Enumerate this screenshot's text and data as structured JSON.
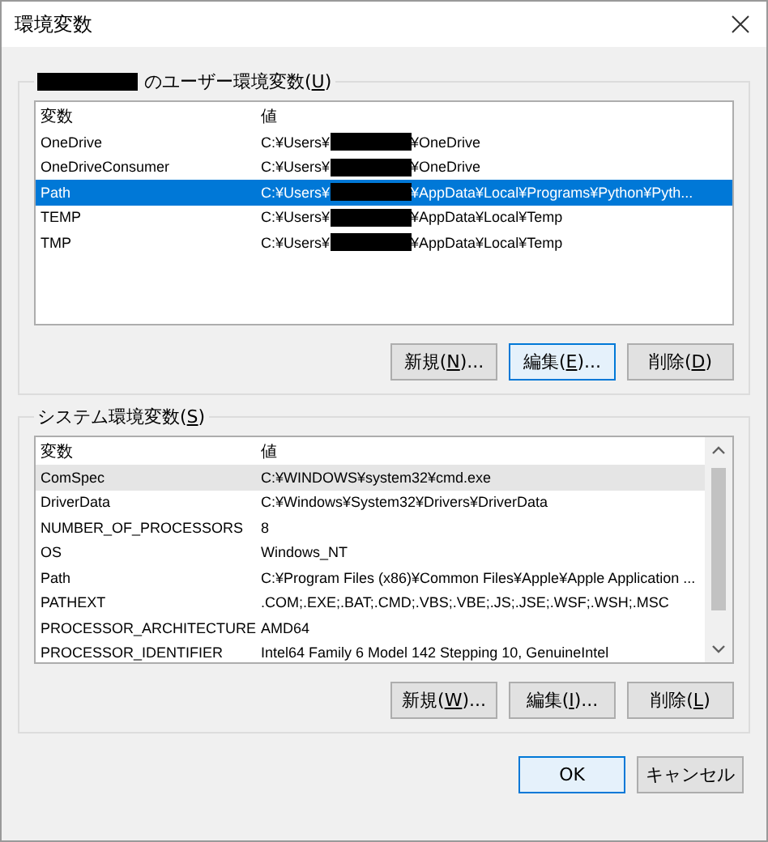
{
  "window": {
    "title": "環境変数"
  },
  "user_group": {
    "label_redacted": true,
    "label_parts": [
      "のユーザー環境変数(",
      "U",
      ")"
    ],
    "list": {
      "focused": true,
      "columns": [
        "変数",
        "値"
      ],
      "rows": [
        {
          "name": "OneDrive",
          "value_prefix": "C:¥Users¥",
          "redacted": true,
          "value_suffix": "¥OneDrive",
          "selected": false
        },
        {
          "name": "OneDriveConsumer",
          "value_prefix": "C:¥Users¥",
          "redacted": true,
          "value_suffix": "¥OneDrive",
          "selected": false
        },
        {
          "name": "Path",
          "value_prefix": "C:¥Users¥",
          "redacted": true,
          "value_suffix": "¥AppData¥Local¥Programs¥Python¥Pyth...",
          "selected": true
        },
        {
          "name": "TEMP",
          "value_prefix": "C:¥Users¥",
          "redacted": true,
          "value_suffix": "¥AppData¥Local¥Temp",
          "selected": false
        },
        {
          "name": "TMP",
          "value_prefix": "C:¥Users¥",
          "redacted": true,
          "value_suffix": "¥AppData¥Local¥Temp",
          "selected": false
        }
      ]
    },
    "buttons": [
      {
        "parts": [
          "新規(",
          "N",
          ")..."
        ],
        "default": false
      },
      {
        "parts": [
          "編集(",
          "E",
          ")..."
        ],
        "default": true
      },
      {
        "parts": [
          "削除(",
          "D",
          ")"
        ],
        "default": false
      }
    ]
  },
  "system_group": {
    "label_parts": [
      "システム環境変数(",
      "S",
      ")"
    ],
    "list": {
      "focused": false,
      "columns": [
        "変数",
        "値"
      ],
      "rows": [
        {
          "name": "ComSpec",
          "value_prefix": "C:¥WINDOWS¥system32¥cmd.exe",
          "redacted": false,
          "selected": true
        },
        {
          "name": "DriverData",
          "value_prefix": "C:¥Windows¥System32¥Drivers¥DriverData",
          "redacted": false,
          "selected": false
        },
        {
          "name": "NUMBER_OF_PROCESSORS",
          "value_prefix": "8",
          "redacted": false,
          "selected": false
        },
        {
          "name": "OS",
          "value_prefix": "Windows_NT",
          "redacted": false,
          "selected": false
        },
        {
          "name": "Path",
          "value_prefix": "C:¥Program Files (x86)¥Common Files¥Apple¥Apple Application ...",
          "redacted": false,
          "selected": false
        },
        {
          "name": "PATHEXT",
          "value_prefix": ".COM;.EXE;.BAT;.CMD;.VBS;.VBE;.JS;.JSE;.WSF;.WSH;.MSC",
          "redacted": false,
          "selected": false
        },
        {
          "name": "PROCESSOR_ARCHITECTURE",
          "value_prefix": "AMD64",
          "redacted": false,
          "selected": false
        },
        {
          "name": "PROCESSOR_IDENTIFIER",
          "value_prefix": "Intel64 Family 6 Model 142 Stepping 10, GenuineIntel",
          "redacted": false,
          "selected": false
        }
      ]
    },
    "buttons": [
      {
        "parts": [
          "新規(",
          "W",
          ")..."
        ],
        "default": false
      },
      {
        "parts": [
          "編集(",
          "I",
          ")..."
        ],
        "default": false
      },
      {
        "parts": [
          "削除(",
          "L",
          ")"
        ],
        "default": false
      }
    ]
  },
  "dialog_buttons": [
    {
      "parts": [
        "OK"
      ],
      "default": true
    },
    {
      "parts": [
        "キャンセル"
      ],
      "default": false
    }
  ]
}
